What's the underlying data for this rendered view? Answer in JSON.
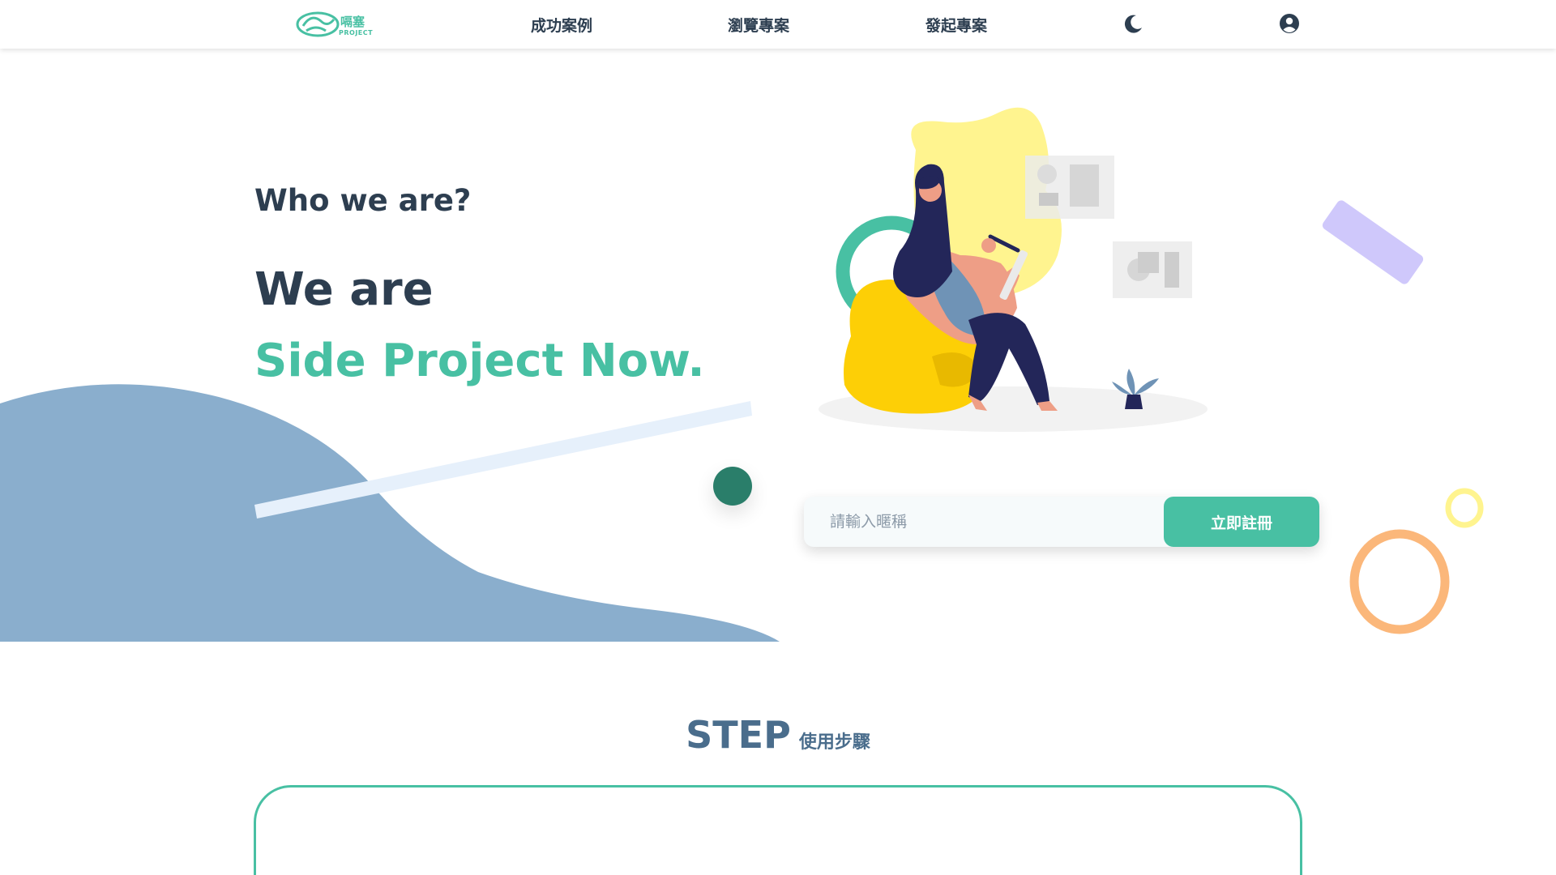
{
  "navbar": {
    "logo": {
      "name": "嗝塞",
      "sub": "PROJECT"
    },
    "links": [
      {
        "label": "成功案例"
      },
      {
        "label": "瀏覽專案"
      },
      {
        "label": "發起專案"
      }
    ],
    "icons": {
      "theme": "moon-icon",
      "user": "user-circle-icon"
    }
  },
  "hero": {
    "who": "Who we are?",
    "we_are": "We are",
    "brand": "Side Project Now."
  },
  "signup": {
    "placeholder": "請輸入暱稱",
    "button": "立即註冊"
  },
  "step": {
    "title_en": "STEP",
    "title_zh": "使用步驟"
  },
  "colors": {
    "accent": "#48c0a3",
    "text": "#2d3e50",
    "blob": "#8aaecd",
    "yellow": "#fff48f",
    "purple": "#cfc8fb",
    "orange": "#fbb77a"
  }
}
